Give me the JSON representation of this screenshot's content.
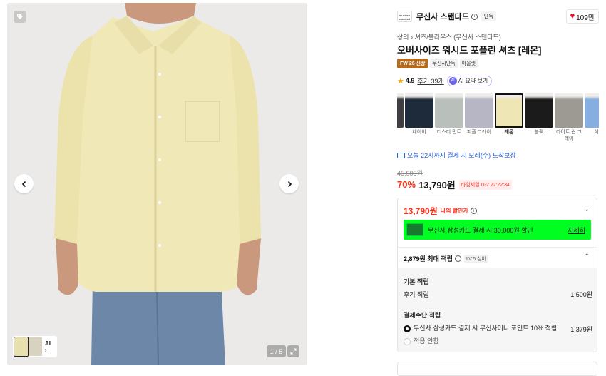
{
  "gallery": {
    "counter": "1 / 5",
    "thumb_ai_label": "AI",
    "shirt_color": "#f1e8b8",
    "jeans_color": "#6d87a8"
  },
  "brand": {
    "logo_text": "musinsa standard",
    "name": "무신사 스탠다드",
    "badge": "단독",
    "like_count": "109만"
  },
  "breadcrumb": {
    "items": [
      "상의",
      "셔츠/블라우스 (무신사 스탠다드)"
    ]
  },
  "product": {
    "title": "오버사이즈 워시드 포플린 셔츠 [레몬]",
    "badges": [
      "FW 26 신상",
      "무신사단독",
      "아울렛"
    ]
  },
  "rating": {
    "score": "4.9",
    "reviews": "후기 39개",
    "ai_icon": "AI",
    "ai_summary": "AI 요약 보기"
  },
  "colors": [
    {
      "label": "지",
      "hex": "#3d3d42",
      "selected": false
    },
    {
      "label": "네이비",
      "hex": "#1e2b3a",
      "selected": false
    },
    {
      "label": "더스티 민트",
      "hex": "#b9c0bb",
      "selected": false
    },
    {
      "label": "퍼플 그레이",
      "hex": "#b6b6c4",
      "selected": false
    },
    {
      "label": "레몬",
      "hex": "#efe6b6",
      "selected": true
    },
    {
      "label": "블랙",
      "hex": "#1b1b1b",
      "selected": false
    },
    {
      "label": "라이트 웜 그레이",
      "hex": "#9d9a94",
      "selected": false
    },
    {
      "label": "삭스",
      "hex": "#86aede",
      "selected": false
    }
  ],
  "delivery": {
    "text": "오늘 22시까지 결제 시 모레(수) 도착보장"
  },
  "price": {
    "original": "45,900원",
    "discount": "70%",
    "current": "13,790원",
    "timesale": "타임세일 D-2 22:22:34"
  },
  "benefits": {
    "my_price": "13,790원",
    "my_price_label": "나의 할인가",
    "card_text": "무신사 삼성카드 결제 시 30,000원 할인",
    "card_detail": "자세히",
    "points_title": "2,879원 최대 적립",
    "level": "LV.5 실버",
    "basic_title": "기본 적립",
    "review_label": "후기 적립",
    "review_value": "1,500원",
    "pay_title": "결제수단 적립",
    "pay_option": "무신사 삼성카드 결제 시 무신사머니 포인트 10% 적립",
    "pay_value": "1,379원",
    "no_apply": "적용 안함"
  }
}
